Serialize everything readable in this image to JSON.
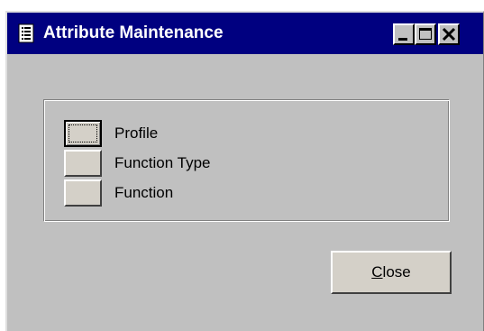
{
  "window": {
    "title": "Attribute Maintenance",
    "title_icon": "document-icon",
    "controls": [
      "minimize-icon",
      "maximize-icon",
      "close-icon"
    ]
  },
  "options": [
    {
      "label": "Profile",
      "focused": true
    },
    {
      "label": "Function Type",
      "focused": false
    },
    {
      "label": "Function",
      "focused": false
    }
  ],
  "close_button": {
    "mnemonic": "C",
    "rest": "lose"
  },
  "colors": {
    "titlebar": "#000080",
    "face": "#c0c0c0",
    "button": "#d4d0c8"
  }
}
